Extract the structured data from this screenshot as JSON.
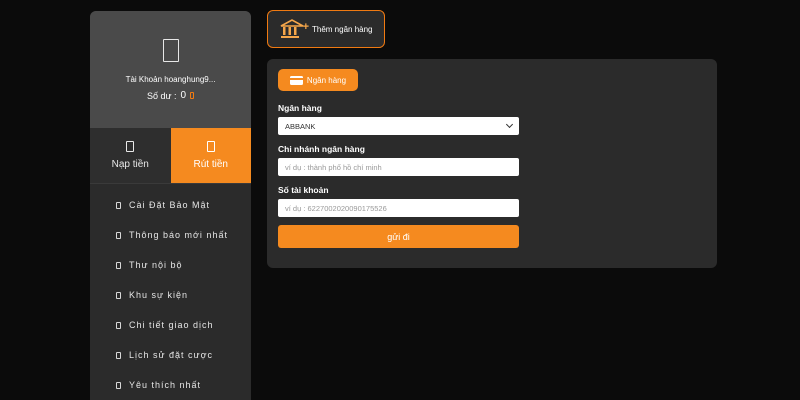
{
  "profile": {
    "account_label": "Tài Khoản hoanghung9...",
    "balance_label": "Số dư :",
    "balance_value": "0"
  },
  "tabs": {
    "deposit": "Nạp tiền",
    "withdraw": "Rút tiền"
  },
  "menu": {
    "items": [
      {
        "label": "Cài Đặt Bảo Mật"
      },
      {
        "label": "Thông báo mới nhất"
      },
      {
        "label": "Thư nội bộ"
      },
      {
        "label": "Khu sự kiện"
      },
      {
        "label": "Chi tiết giao dịch"
      },
      {
        "label": "Lịch sử đặt cược"
      },
      {
        "label": "Yêu thích nhất"
      }
    ]
  },
  "add_bank": {
    "label": "Thêm ngân hàng",
    "icon": "bank-icon"
  },
  "form": {
    "tab_label": "Ngân hàng",
    "bank_label": "Ngân hàng",
    "bank_value": "ABBANK",
    "branch_label": "Chi nhánh ngân hàng",
    "branch_placeholder": "ví dụ : thành phố hồ chí minh",
    "account_label": "Số tài khoản",
    "account_placeholder": "ví dụ : 6227002020090175526",
    "submit_label": "gửi đi"
  },
  "colors": {
    "accent": "#f58a1f",
    "background": "#0b0b0b",
    "panel": "#2b2b2b",
    "profile_bg": "#4a4a4a"
  }
}
